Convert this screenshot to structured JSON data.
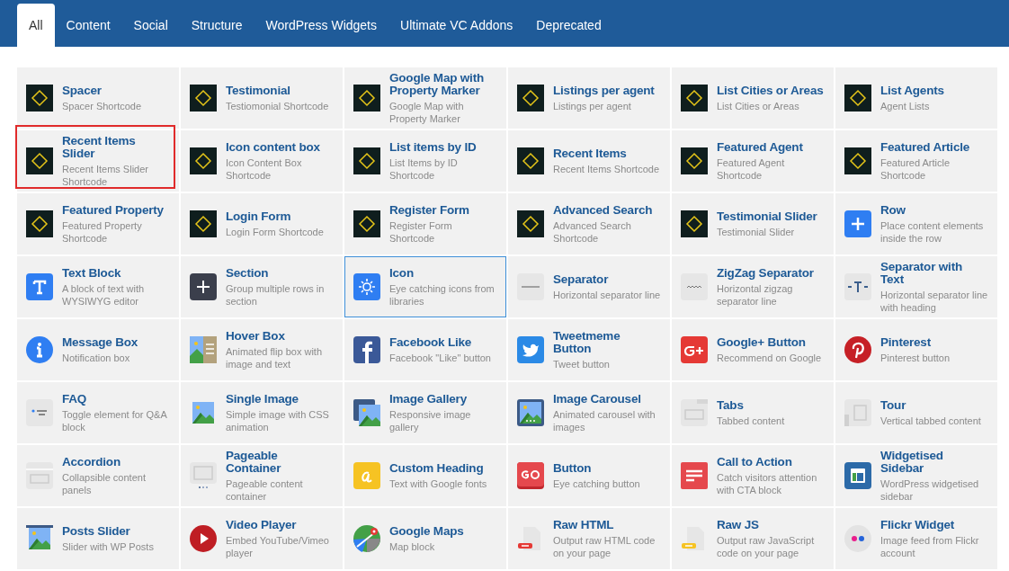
{
  "tabs": [
    {
      "label": "All",
      "selected": true
    },
    {
      "label": "Content",
      "selected": false
    },
    {
      "label": "Social",
      "selected": false
    },
    {
      "label": "Structure",
      "selected": false
    },
    {
      "label": "WordPress Widgets",
      "selected": false
    },
    {
      "label": "Ultimate VC Addons",
      "selected": false
    },
    {
      "label": "Deprecated",
      "selected": false
    }
  ],
  "elements": [
    {
      "kind": "theme",
      "title": "Spacer",
      "description": "Spacer Shortcode",
      "selected": false,
      "highlighted": false
    },
    {
      "kind": "theme",
      "title": "Testimonial",
      "description": "Testiomonial Shortcode",
      "selected": false,
      "highlighted": false
    },
    {
      "kind": "theme",
      "title": "Google Map with Property Marker",
      "description": "Google Map with Property Marker",
      "selected": false,
      "highlighted": false
    },
    {
      "kind": "theme",
      "title": "Listings per agent",
      "description": "Listings per agent",
      "selected": false,
      "highlighted": false
    },
    {
      "kind": "theme",
      "title": "List Cities or Areas",
      "description": "List Cities or Areas",
      "selected": false,
      "highlighted": false
    },
    {
      "kind": "theme",
      "title": "List Agents",
      "description": "Agent Lists",
      "selected": false,
      "highlighted": false
    },
    {
      "kind": "theme",
      "title": "Recent Items Slider",
      "description": "Recent Items Slider Shortcode",
      "selected": false,
      "highlighted": true
    },
    {
      "kind": "theme",
      "title": "Icon content box",
      "description": "Icon Content Box Shortcode",
      "selected": false,
      "highlighted": false
    },
    {
      "kind": "theme",
      "title": "List items by ID",
      "description": "List Items by ID Shortcode",
      "selected": false,
      "highlighted": false
    },
    {
      "kind": "theme",
      "title": "Recent Items",
      "description": "Recent Items Shortcode",
      "selected": false,
      "highlighted": false
    },
    {
      "kind": "theme",
      "title": "Featured Agent",
      "description": "Featured Agent Shortcode",
      "selected": false,
      "highlighted": false
    },
    {
      "kind": "theme",
      "title": "Featured Article",
      "description": "Featured Article Shortcode",
      "selected": false,
      "highlighted": false
    },
    {
      "kind": "theme",
      "title": "Featured Property",
      "description": "Featured Property Shortcode",
      "selected": false,
      "highlighted": false
    },
    {
      "kind": "theme",
      "title": "Login Form",
      "description": "Login Form Shortcode",
      "selected": false,
      "highlighted": false
    },
    {
      "kind": "theme",
      "title": "Register Form",
      "description": "Register Form Shortcode",
      "selected": false,
      "highlighted": false
    },
    {
      "kind": "theme",
      "title": "Advanced Search",
      "description": "Advanced Search Shortcode",
      "selected": false,
      "highlighted": false
    },
    {
      "kind": "theme",
      "title": "Testimonial Slider",
      "description": "Testimonial Slider",
      "selected": false,
      "highlighted": false
    },
    {
      "kind": "row",
      "title": "Row",
      "description": "Place content elements inside the row",
      "selected": false,
      "highlighted": false
    },
    {
      "kind": "text",
      "title": "Text Block",
      "description": "A block of text with WYSIWYG editor",
      "selected": false,
      "highlighted": false
    },
    {
      "kind": "section",
      "title": "Section",
      "description": "Group multiple rows in section",
      "selected": false,
      "highlighted": false
    },
    {
      "kind": "icon",
      "title": "Icon",
      "description": "Eye catching icons from libraries",
      "selected": true,
      "highlighted": false
    },
    {
      "kind": "separator",
      "title": "Separator",
      "description": "Horizontal separator line",
      "selected": false,
      "highlighted": false
    },
    {
      "kind": "zigzag",
      "title": "ZigZag Separator",
      "description": "Horizontal zigzag separator line",
      "selected": false,
      "highlighted": false
    },
    {
      "kind": "septext",
      "title": "Separator with Text",
      "description": "Horizontal separator line with heading",
      "selected": false,
      "highlighted": false
    },
    {
      "kind": "message",
      "title": "Message Box",
      "description": "Notification box",
      "selected": false,
      "highlighted": false
    },
    {
      "kind": "hover",
      "title": "Hover Box",
      "description": "Animated flip box with image and text",
      "selected": false,
      "highlighted": false
    },
    {
      "kind": "facebook",
      "title": "Facebook Like",
      "description": "Facebook \"Like\" button",
      "selected": false,
      "highlighted": false
    },
    {
      "kind": "twitter",
      "title": "Tweetmeme Button",
      "description": "Tweet button",
      "selected": false,
      "highlighted": false
    },
    {
      "kind": "gplus",
      "title": "Google+ Button",
      "description": "Recommend on Google",
      "selected": false,
      "highlighted": false
    },
    {
      "kind": "pinterest",
      "title": "Pinterest",
      "description": "Pinterest button",
      "selected": false,
      "highlighted": false
    },
    {
      "kind": "faq",
      "title": "FAQ",
      "description": "Toggle element for Q&A block",
      "selected": false,
      "highlighted": false
    },
    {
      "kind": "image",
      "title": "Single Image",
      "description": "Simple image with CSS animation",
      "selected": false,
      "highlighted": false
    },
    {
      "kind": "gallery",
      "title": "Image Gallery",
      "description": "Responsive image gallery",
      "selected": false,
      "highlighted": false
    },
    {
      "kind": "carousel",
      "title": "Image Carousel",
      "description": "Animated carousel with images",
      "selected": false,
      "highlighted": false
    },
    {
      "kind": "tabs",
      "title": "Tabs",
      "description": "Tabbed content",
      "selected": false,
      "highlighted": false
    },
    {
      "kind": "tour",
      "title": "Tour",
      "description": "Vertical tabbed content",
      "selected": false,
      "highlighted": false
    },
    {
      "kind": "accordion",
      "title": "Accordion",
      "description": "Collapsible content panels",
      "selected": false,
      "highlighted": false
    },
    {
      "kind": "pageable",
      "title": "Pageable Container",
      "description": "Pageable content container",
      "selected": false,
      "highlighted": false
    },
    {
      "kind": "heading",
      "title": "Custom Heading",
      "description": "Text with Google fonts",
      "selected": false,
      "highlighted": false
    },
    {
      "kind": "button",
      "title": "Button",
      "description": "Eye catching button",
      "selected": false,
      "highlighted": false
    },
    {
      "kind": "cta",
      "title": "Call to Action",
      "description": "Catch visitors attention with CTA block",
      "selected": false,
      "highlighted": false
    },
    {
      "kind": "widget",
      "title": "Widgetised Sidebar",
      "description": "WordPress widgetised sidebar",
      "selected": false,
      "highlighted": false
    },
    {
      "kind": "slider",
      "title": "Posts Slider",
      "description": "Slider with WP Posts",
      "selected": false,
      "highlighted": false
    },
    {
      "kind": "video",
      "title": "Video Player",
      "description": "Embed YouTube/Vimeo player",
      "selected": false,
      "highlighted": false
    },
    {
      "kind": "maps",
      "title": "Google Maps",
      "description": "Map block",
      "selected": false,
      "highlighted": false
    },
    {
      "kind": "html",
      "title": "Raw HTML",
      "description": "Output raw HTML code on your page",
      "selected": false,
      "highlighted": false
    },
    {
      "kind": "js",
      "title": "Raw JS",
      "description": "Output raw JavaScript code on your page",
      "selected": false,
      "highlighted": false
    },
    {
      "kind": "flickr",
      "title": "Flickr Widget",
      "description": "Image feed from Flickr account",
      "selected": false,
      "highlighted": false
    }
  ]
}
